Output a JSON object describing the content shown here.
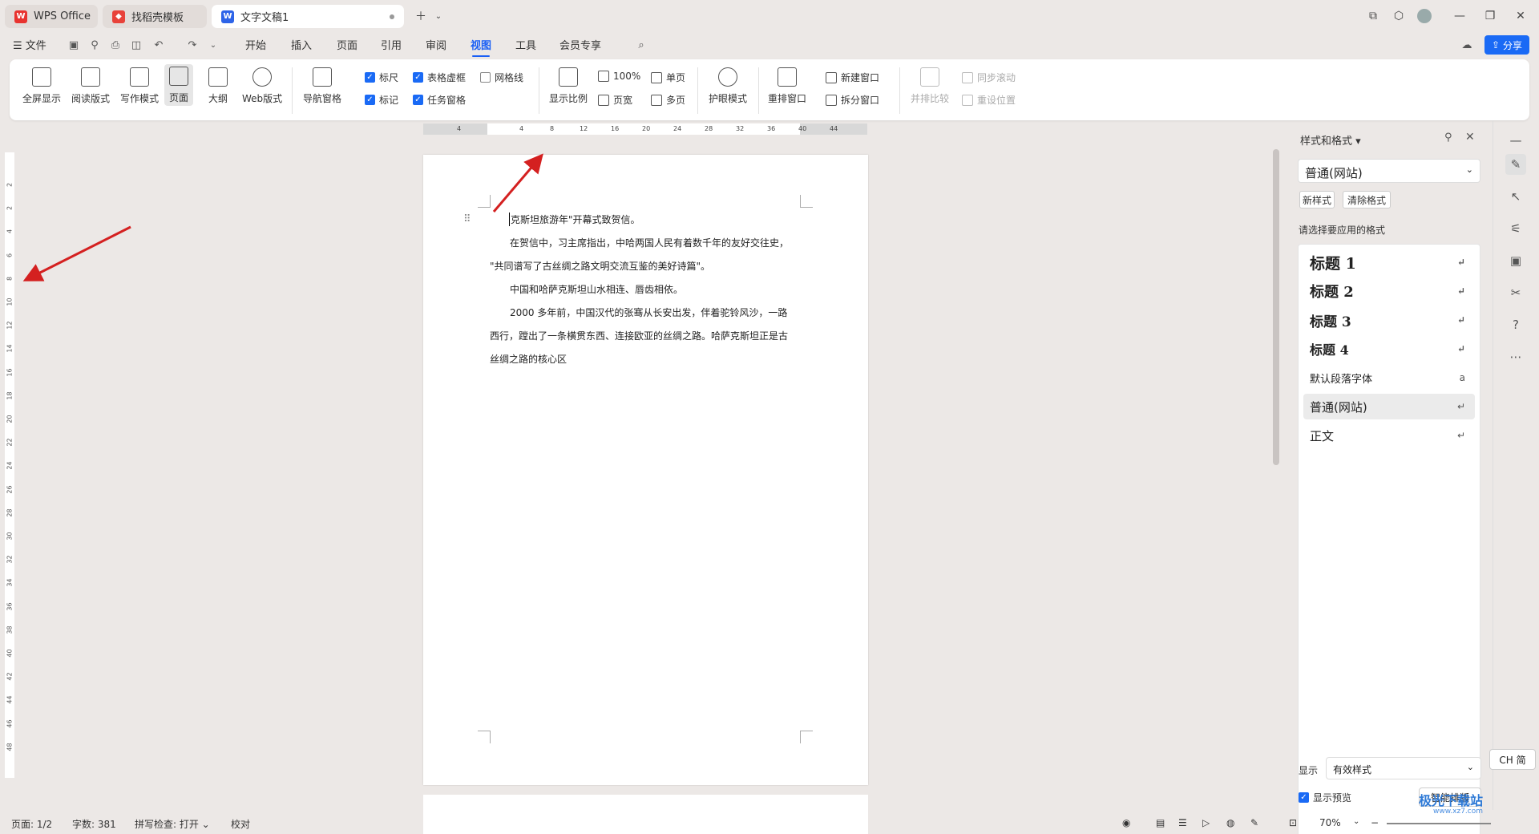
{
  "tabs": [
    {
      "label": "WPS Office"
    },
    {
      "label": "找稻壳模板"
    },
    {
      "label": "文字文稿1"
    }
  ],
  "menubar": {
    "file": "文件",
    "items": [
      "开始",
      "插入",
      "页面",
      "引用",
      "审阅",
      "视图",
      "工具",
      "会员专享"
    ],
    "active": "视图",
    "share": "分享"
  },
  "ribbon": {
    "views": [
      "全屏显示",
      "阅读版式",
      "写作模式",
      "页面",
      "大纲",
      "Web版式"
    ],
    "nav_pane": "导航窗格",
    "checks": [
      {
        "label": "标尺",
        "checked": true
      },
      {
        "label": "表格虚框",
        "checked": true
      },
      {
        "label": "网格线",
        "checked": false
      },
      {
        "label": "标记",
        "checked": true
      },
      {
        "label": "任务窗格",
        "checked": true
      }
    ],
    "zoom": "显示比例",
    "zoom100": "100%",
    "page_width": "页宽",
    "single": "单页",
    "multi": "多页",
    "eye": "护眼模式",
    "arrange": "重排窗口",
    "new_window": "新建窗口",
    "split": "拆分窗口",
    "compare": "并排比较",
    "sync_scroll": "同步滚动",
    "reset_pos": "重设位置"
  },
  "hruler": [
    "4",
    "",
    "4",
    "8",
    "12",
    "16",
    "20",
    "24",
    "28",
    "32",
    "36",
    "40",
    "44"
  ],
  "vruler": [
    "2",
    "2",
    "4",
    "6",
    "8",
    "10",
    "12",
    "14",
    "16",
    "18",
    "20",
    "22",
    "24",
    "26",
    "28",
    "30",
    "32",
    "34",
    "36",
    "38",
    "40",
    "42",
    "44",
    "46",
    "48"
  ],
  "document": {
    "lines": [
      "克斯坦旅游年\"开幕式致贺信。",
      "在贺信中，习主席指出，中哈两国人民有着数千年的友好交往史，",
      "\"共同谱写了古丝绸之路文明交流互鉴的美好诗篇\"。",
      "中国和哈萨克斯坦山水相连、唇齿相依。",
      "2000 多年前，中国汉代的张骞从长安出发，伴着驼铃风沙，一路",
      "西行，蹚出了一条横贯东西、连接欧亚的丝绸之路。哈萨克斯坦正是古",
      "丝绸之路的核心区"
    ]
  },
  "panel": {
    "title": "样式和格式",
    "current": "普通(网站)",
    "new_style": "新样式",
    "clear_format": "清除格式",
    "prompt": "请选择要应用的格式",
    "styles": [
      "标题  1",
      "标题  2",
      "标题  3",
      "标题 4",
      "默认段落字体",
      "普通(网站)",
      "正文"
    ],
    "selected": "普通(网站)",
    "show_label": "显示",
    "show_value": "有效样式",
    "preview": "显示预览",
    "smart": "智能排版"
  },
  "ime": "CH 简",
  "status": {
    "page": "页面: 1/2",
    "words": "字数: 381",
    "spell": "拼写检查: 打开",
    "proof": "校对",
    "zoom": "70%"
  },
  "watermark": {
    "name": "极光下载站",
    "url": "www.xz7.com"
  },
  "colors": {
    "accent": "#1a6af5",
    "arrow": "#d42020",
    "background": "#ece8e6"
  }
}
